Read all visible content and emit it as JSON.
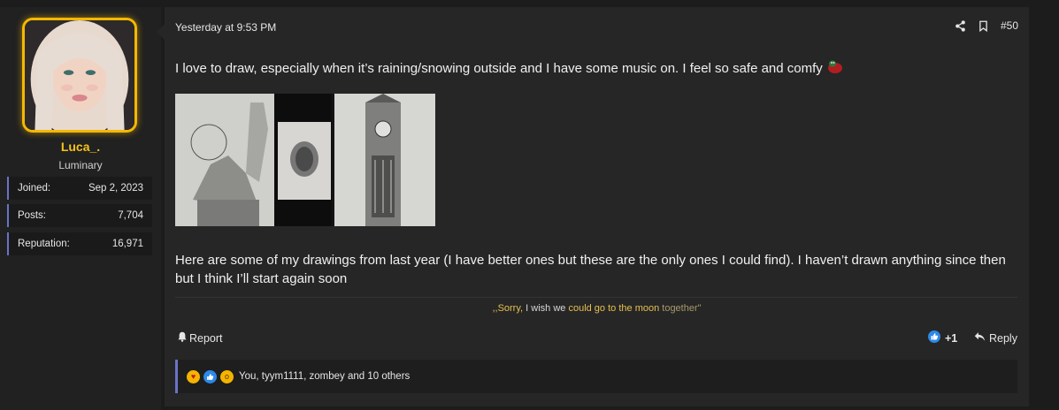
{
  "user": {
    "username": "Luca_.",
    "title": "Luminary",
    "stats": [
      {
        "label": "Joined:",
        "value": "Sep 2, 2023"
      },
      {
        "label": "Posts:",
        "value": "7,704"
      },
      {
        "label": "Reputation:",
        "value": "16,971"
      }
    ]
  },
  "post": {
    "date": "Yesterday at 9:53 PM",
    "number": "#50",
    "text1": "I love to draw, especially when it’s raining/snowing outside and I have some music on. I feel so safe and comfy",
    "text2": "Here are some of my drawings from last year (I have better ones but these are the only ones I could find). I haven’t drawn anything since then but I think I’ll start again soon",
    "signature": {
      "open": ",,Sorry, ",
      "part1": "I wish we ",
      "part2": "could go to the ",
      "part3": "moon ",
      "part4": "together\""
    }
  },
  "actions": {
    "report": "Report",
    "reaction_count": "+1",
    "reply": "Reply"
  },
  "reactions": {
    "summary": "You, tyym1111, zombey and 10 others"
  },
  "colors": {
    "accent": "#6a73c8",
    "username": "#f7c21a",
    "avatar_border": "#f5b800"
  }
}
